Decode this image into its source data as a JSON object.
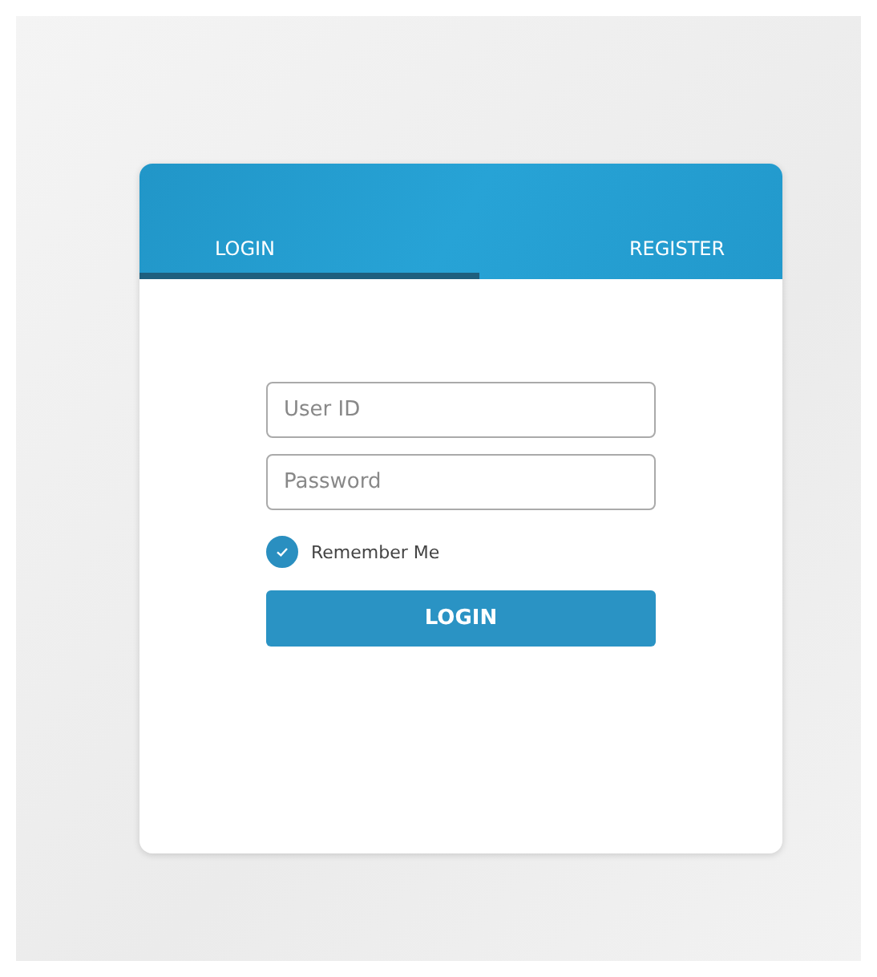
{
  "tabs": [
    {
      "label": "LOGIN",
      "selected": true
    },
    {
      "label": "REGISTER",
      "selected": false
    }
  ],
  "fields": [
    {
      "placeholder": "User ID"
    },
    {
      "placeholder": "Password"
    }
  ],
  "remember": {
    "label": "Remember Me",
    "checked": true
  },
  "submit": "LOGIN"
}
